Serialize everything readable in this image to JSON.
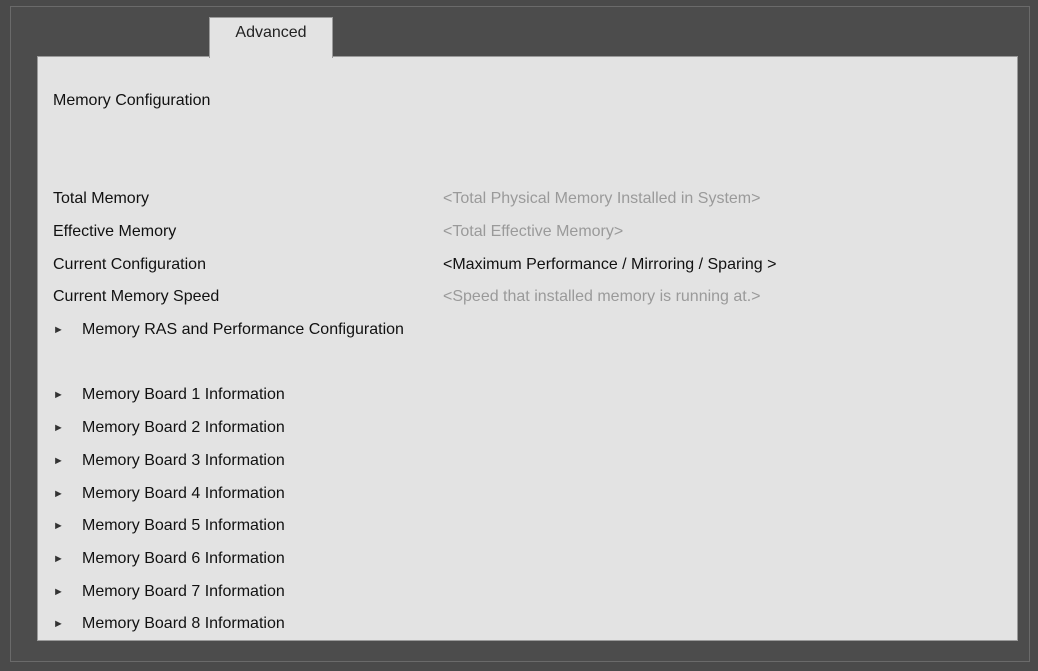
{
  "tabs": {
    "active": "Advanced"
  },
  "page_title": "Memory Configuration",
  "info": [
    {
      "label": "Total Memory",
      "value": "<Total Physical Memory Installed in System>"
    },
    {
      "label": "Effective Memory",
      "value": "<Total Effective Memory>"
    },
    {
      "label": "Current Configuration",
      "value": "<Maximum Performance / Mirroring / Sparing >"
    },
    {
      "label": "Current Memory Speed",
      "value": "<Speed that installed memory is running at.>"
    }
  ],
  "ras_submenu": {
    "arrow": "►",
    "label": "Memory RAS and Performance Configuration"
  },
  "boards": [
    {
      "arrow": "►",
      "label": "Memory Board 1 Information"
    },
    {
      "arrow": "►",
      "label": "Memory Board 2 Information"
    },
    {
      "arrow": "►",
      "label": "Memory Board 3 Information"
    },
    {
      "arrow": "►",
      "label": "Memory Board 4 Information"
    },
    {
      "arrow": "►",
      "label": "Memory Board 5 Information"
    },
    {
      "arrow": "►",
      "label": "Memory Board 6 Information"
    },
    {
      "arrow": "►",
      "label": "Memory Board 7 Information"
    },
    {
      "arrow": "►",
      "label": "Memory Board 8 Information"
    }
  ],
  "colors": {
    "background": "#4a4a4a",
    "panel": "#e3e3e3",
    "dim_text": "#9a9a9a",
    "text": "#111111"
  }
}
